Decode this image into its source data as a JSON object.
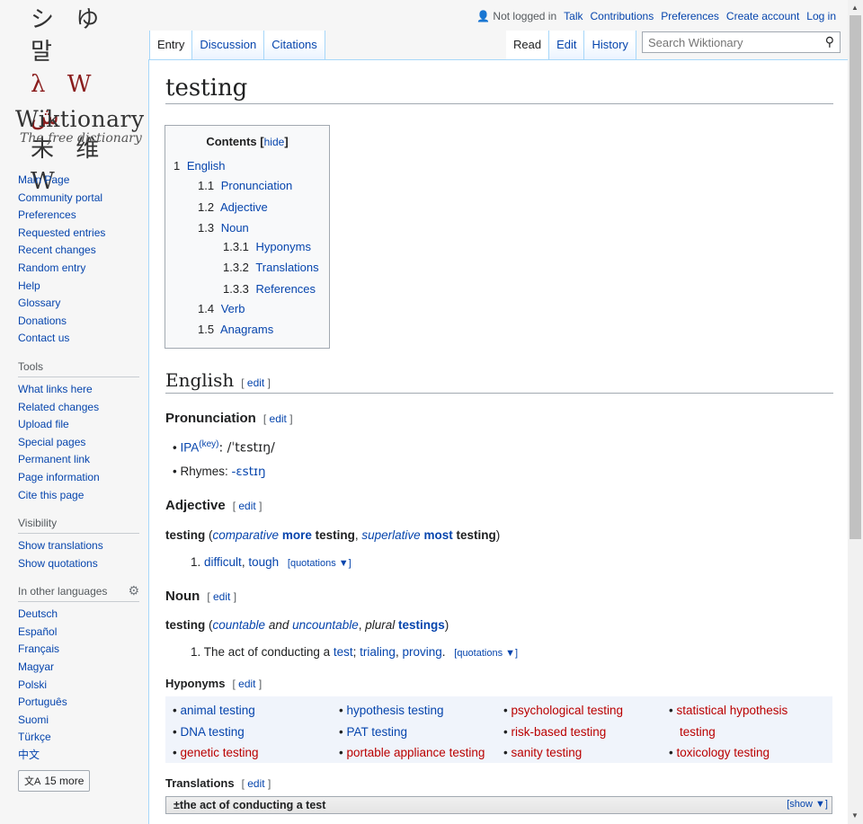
{
  "logo": {
    "glyphs_line1": "シ ゆ 말",
    "glyphs_line2": "λ W ش",
    "glyphs_line3": "未 维 W",
    "wordmark": "Wiktionary",
    "tagline": "The free dictionary"
  },
  "sidebar": {
    "nav": [
      "Main Page",
      "Community portal",
      "Preferences",
      "Requested entries",
      "Recent changes",
      "Random entry",
      "Help",
      "Glossary",
      "Donations",
      "Contact us"
    ],
    "tools_heading": "Tools",
    "tools": [
      "What links here",
      "Related changes",
      "Upload file",
      "Special pages",
      "Permanent link",
      "Page information",
      "Cite this page"
    ],
    "visibility_heading": "Visibility",
    "visibility": [
      "Show translations",
      "Show quotations"
    ],
    "languages_heading": "In other languages",
    "languages": [
      "Deutsch",
      "Español",
      "Français",
      "Magyar",
      "Polski",
      "Português",
      "Suomi",
      "Türkçe",
      "中文"
    ],
    "more_languages": "15 more"
  },
  "personal": {
    "user": "Not logged in",
    "links": [
      "Talk",
      "Contributions",
      "Preferences",
      "Create account",
      "Log in"
    ]
  },
  "tabs": {
    "left": [
      "Entry",
      "Discussion",
      "Citations"
    ],
    "right": [
      "Read",
      "Edit",
      "History"
    ]
  },
  "search": {
    "placeholder": "Search Wiktionary"
  },
  "page": {
    "title": "testing",
    "edit_label": "edit",
    "toc": {
      "title": "Contents",
      "hide": "hide",
      "entries": [
        {
          "num": "1",
          "label": "English"
        },
        {
          "num": "1.1",
          "label": "Pronunciation"
        },
        {
          "num": "1.2",
          "label": "Adjective"
        },
        {
          "num": "1.3",
          "label": "Noun"
        },
        {
          "num": "1.3.1",
          "label": "Hyponyms"
        },
        {
          "num": "1.3.2",
          "label": "Translations"
        },
        {
          "num": "1.3.3",
          "label": "References"
        },
        {
          "num": "1.4",
          "label": "Verb"
        },
        {
          "num": "1.5",
          "label": "Anagrams"
        }
      ]
    },
    "english_heading": "English",
    "pronunciation": {
      "heading": "Pronunciation",
      "ipa_label": "IPA",
      "ipa_key": "(key)",
      "ipa_value": ": /ˈtɛstɪŋ/",
      "rhymes_label": "Rhymes: ",
      "rhymes_value": "-ɛstɪŋ"
    },
    "adjective": {
      "heading": "Adjective",
      "headword": "testing",
      "comparative": "comparative",
      "more": "more",
      "superlative": "superlative",
      "most": "most",
      "def_num": "1.",
      "def_links": [
        "difficult",
        "tough"
      ],
      "quotations": "[quotations ▼]"
    },
    "noun": {
      "heading": "Noun",
      "headword": "testing",
      "countable": "countable",
      "and": "and",
      "uncountable": "uncountable",
      "plural": "plural",
      "plural_form": "testings",
      "def_num": "1.",
      "def_text": "The act of conducting a",
      "def_link1": "test",
      "def_link2": "trialing",
      "def_link3": "proving",
      "quotations": "[quotations ▼]"
    },
    "hyponyms": {
      "heading": "Hyponyms",
      "col1": [
        {
          "t": "animal testing",
          "red": false
        },
        {
          "t": "DNA testing",
          "red": false
        },
        {
          "t": "genetic testing",
          "red": true
        }
      ],
      "col2": [
        {
          "t": "hypothesis testing",
          "red": false
        },
        {
          "t": "PAT testing",
          "red": false
        },
        {
          "t": "portable appliance testing",
          "red": true
        }
      ],
      "col3": [
        {
          "t": "psychological testing",
          "red": true
        },
        {
          "t": "risk-based testing",
          "red": true
        },
        {
          "t": "sanity testing",
          "red": true
        }
      ],
      "col4_first_line1": "statistical hypothesis",
      "col4_first_line2": "testing",
      "col4_last": "toxicology testing"
    },
    "translations": {
      "heading": "Translations",
      "box_label": "the act of conducting a test",
      "show": "[show ▼]"
    }
  },
  "colors": {
    "link": "#0645ad",
    "redlink": "#ba0000",
    "tab_border": "#a7d7f9"
  }
}
